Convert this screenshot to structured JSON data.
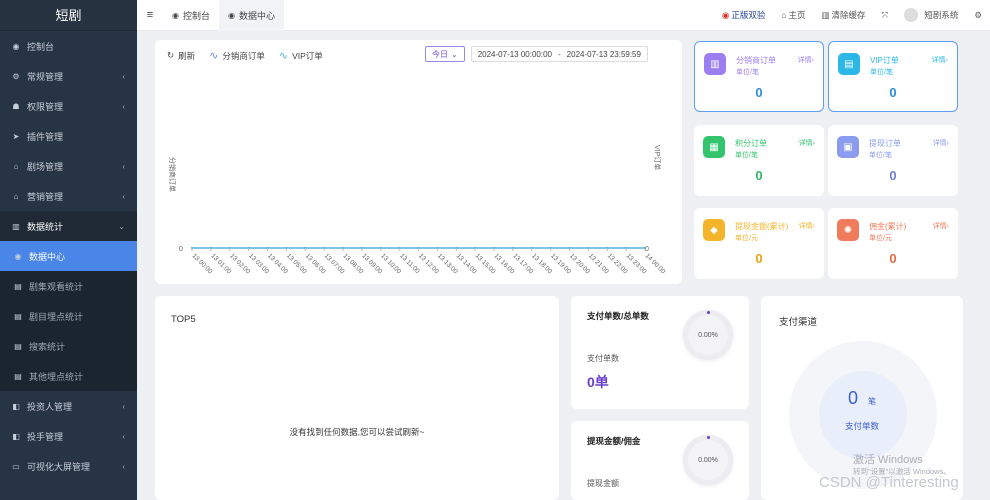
{
  "sidebar": {
    "brand": "短剧",
    "items": [
      {
        "label": "控制台",
        "icon": "dashboard-icon",
        "glyph": "◉",
        "arrow": ""
      },
      {
        "label": "常规管理",
        "icon": "cogs-icon",
        "glyph": "⚙",
        "arrow": "‹"
      },
      {
        "label": "权限管理",
        "icon": "users-icon",
        "glyph": "☗",
        "arrow": "‹"
      },
      {
        "label": "插件管理",
        "icon": "rocket-icon",
        "glyph": "➤",
        "arrow": ""
      },
      {
        "label": "剧场管理",
        "icon": "home-icon",
        "glyph": "⌂",
        "arrow": "‹"
      },
      {
        "label": "营销管理",
        "icon": "home-icon",
        "glyph": "⌂",
        "arrow": "‹"
      },
      {
        "label": "数据统计",
        "icon": "bar-chart-icon",
        "glyph": "▥",
        "arrow": "⌄"
      },
      {
        "label": "数据中心",
        "icon": "dashboard-icon",
        "glyph": "◉",
        "arrow": ""
      },
      {
        "label": "剧集观看统计",
        "icon": "list-icon",
        "glyph": "▤",
        "arrow": ""
      },
      {
        "label": "剧目埋点统计",
        "icon": "list-icon",
        "glyph": "▤",
        "arrow": ""
      },
      {
        "label": "搜索统计",
        "icon": "list-icon",
        "glyph": "▤",
        "arrow": ""
      },
      {
        "label": "其他埋点统计",
        "icon": "list-icon",
        "glyph": "▤",
        "arrow": ""
      },
      {
        "label": "投资人管理",
        "icon": "book-icon",
        "glyph": "◧",
        "arrow": "‹"
      },
      {
        "label": "投手管理",
        "icon": "book-icon",
        "glyph": "◧",
        "arrow": "‹"
      },
      {
        "label": "可视化大屏管理",
        "icon": "screen-icon",
        "glyph": "▭",
        "arrow": "‹"
      }
    ]
  },
  "topbar": {
    "menu_glyph": "≡",
    "tabs": [
      {
        "label": "控制台",
        "glyph": "◉"
      },
      {
        "label": "数据中心",
        "glyph": "◉"
      }
    ],
    "right": {
      "genuine_glyph": "◉",
      "genuine": "正版双验",
      "home_glyph": "⌂",
      "home": "主页",
      "clear_glyph": "▥",
      "clear_cache": "清除缓存",
      "fullscreen_glyph": "⤧",
      "user": "短剧系统",
      "settings_glyph": "⚙"
    }
  },
  "chart": {
    "refresh_glyph": "↻",
    "refresh": "刷新",
    "legend_glyph": "∿",
    "today": "今日",
    "today_caret": "⌄",
    "range_start": "2024-07-13 00:00:00",
    "range_sep": "-",
    "range_end": "2024-07-13 23:59:59"
  },
  "chart_data": {
    "type": "line",
    "series": [
      {
        "name": "分销商订单",
        "color": "#6a8ff0",
        "values": [
          0,
          0,
          0,
          0,
          0,
          0,
          0,
          0,
          0,
          0,
          0,
          0,
          0,
          0,
          0,
          0,
          0,
          0,
          0,
          0,
          0,
          0,
          0,
          0,
          0
        ]
      },
      {
        "name": "VIP订单",
        "color": "#49b6d6",
        "values": [
          0,
          0,
          0,
          0,
          0,
          0,
          0,
          0,
          0,
          0,
          0,
          0,
          0,
          0,
          0,
          0,
          0,
          0,
          0,
          0,
          0,
          0,
          0,
          0,
          0
        ]
      }
    ],
    "x": [
      "13 00:00",
      "13 01:00",
      "13 02:00",
      "13 03:00",
      "13 04:00",
      "13 05:00",
      "13 06:00",
      "13 07:00",
      "13 08:00",
      "13 09:00",
      "13 10:00",
      "13 11:00",
      "13 12:00",
      "13 13:00",
      "13 14:00",
      "13 15:00",
      "13 16:00",
      "13 17:00",
      "13 18:00",
      "13 19:00",
      "13 20:00",
      "13 21:00",
      "13 22:00",
      "13 23:00",
      "14 00:00"
    ],
    "ylabel_left": "分销商订单",
    "ylabel_right": "VIP订单",
    "yticks_left": [
      "0"
    ],
    "yticks_right": [
      "0"
    ],
    "ylim": [
      0,
      0
    ],
    "grid": false
  },
  "stats": [
    {
      "title": "分销商订单",
      "unit": "单位/笔",
      "detail": "详情›",
      "value": "0",
      "color": "#9b7ff0",
      "valcolor": "#2d8fd8",
      "icon": "bar-chart-icon",
      "glyph": "▥",
      "bordered": true
    },
    {
      "title": "VIP订单",
      "unit": "单位/笔",
      "detail": "详情›",
      "value": "0",
      "color": "#2bb8e6",
      "valcolor": "#2d8fd8",
      "icon": "document-icon",
      "glyph": "▤",
      "bordered": true
    },
    {
      "title": "积分订单",
      "unit": "单位/笔",
      "detail": "详情›",
      "value": "0",
      "color": "#34c46d",
      "valcolor": "#34b868",
      "icon": "calendar-icon",
      "glyph": "▦",
      "bordered": false
    },
    {
      "title": "提现订单",
      "unit": "单位/笔",
      "detail": "详情›",
      "value": "0",
      "color": "#8b9cf0",
      "valcolor": "#6f7fd8",
      "icon": "wallet-icon",
      "glyph": "▣",
      "bordered": false
    },
    {
      "title": "提现金额(累计)",
      "unit": "单位/元",
      "detail": "详情›",
      "value": "0",
      "color": "#f5b52a",
      "valcolor": "#e5a211",
      "icon": "shield-icon",
      "glyph": "◆",
      "bordered": false
    },
    {
      "title": "佣金(累计)",
      "unit": "单位/元",
      "detail": "详情›",
      "value": "0",
      "color": "#f07b5a",
      "valcolor": "#e56a45",
      "icon": "sun-icon",
      "glyph": "✺",
      "bordered": false
    }
  ],
  "top5": {
    "title": "TOP5",
    "empty": "没有找到任何数据,您可以尝试刷新~"
  },
  "pay_count": {
    "title": "支付单数/总单数",
    "label": "支付单数",
    "value": "0单",
    "percent": "0.00%"
  },
  "withdraw": {
    "title": "提现金额/佣金",
    "label": "提现金额",
    "percent": "0.00%"
  },
  "channel": {
    "title": "支付渠道",
    "value": "0",
    "unit": "笔",
    "label": "支付单数"
  },
  "watermark": {
    "line1": "激活 Windows",
    "line2": "转到\"设置\"以激活 Windows。",
    "csdn": "CSDN @Tinteresting"
  }
}
